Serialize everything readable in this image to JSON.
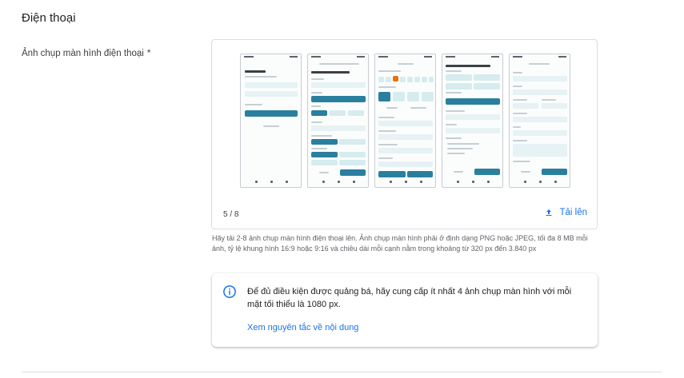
{
  "section": {
    "title": "Điện thoại"
  },
  "screenshot_field": {
    "label": "Ảnh chụp màn hình điện thoại",
    "required_mark": "*",
    "counter": "5 / 8",
    "upload_label": "Tải lên",
    "help_text": "Hãy tải 2-8 ảnh chụp màn hình điện thoại lên. Ảnh chụp màn hình phải ở định dạng PNG hoặc JPEG, tối đa 8 MB mỗi ảnh, tỷ lệ khung hình 16:9 hoặc 9:16 và chiều dài mỗi cạnh nằm trong khoảng từ 320 px đến 3.840 px",
    "thumbnails": [
      {
        "name": "screenshot-1"
      },
      {
        "name": "screenshot-2"
      },
      {
        "name": "screenshot-3"
      },
      {
        "name": "screenshot-4"
      },
      {
        "name": "screenshot-5"
      }
    ]
  },
  "info": {
    "icon": "info-icon",
    "message": "Để đủ điều kiện được quảng bá, hãy cung cấp ít nhất 4 ảnh chụp màn hình với mỗi mặt tối thiểu là 1080 px.",
    "link": "Xem nguyên tắc về nội dung"
  },
  "colors": {
    "accent": "#1a73e8",
    "thumb_primary": "#2a7f9e"
  }
}
